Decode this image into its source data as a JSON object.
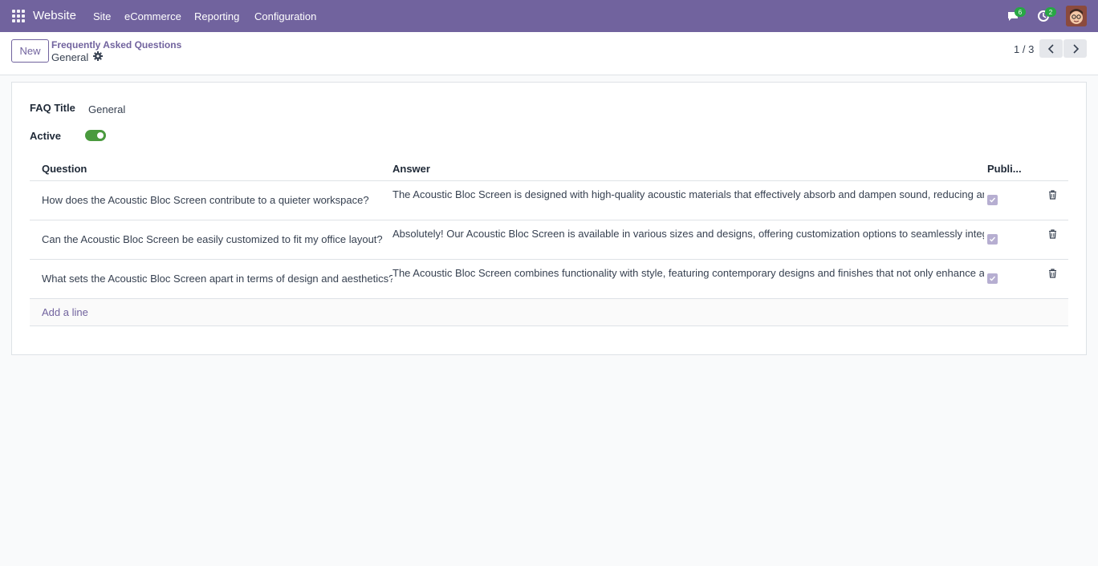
{
  "navbar": {
    "brand": "Website",
    "menu": [
      "Site",
      "eCommerce",
      "Reporting",
      "Configuration"
    ],
    "messages_count": "6",
    "activities_count": "2"
  },
  "control_panel": {
    "new_label": "New",
    "breadcrumb": "Frequently Asked Questions",
    "record_name": "General",
    "pager": "1 / 3"
  },
  "form": {
    "faq_title_label": "FAQ Title",
    "faq_title_value": "General",
    "active_label": "Active",
    "active": true
  },
  "table": {
    "headers": {
      "question": "Question",
      "answer": "Answer",
      "published": "Publi..."
    },
    "rows": [
      {
        "question": "How does the Acoustic Bloc Screen contribute to a quieter workspace?",
        "answer": "The Acoustic Bloc Screen is designed with high-quality acoustic materials that effectively absorb and dampen sound, reducing amb",
        "published": true
      },
      {
        "question": "Can the Acoustic Bloc Screen be easily customized to fit my office layout?",
        "answer": "Absolutely! Our Acoustic Bloc Screen is available in various sizes and designs, offering customization options to seamlessly integra",
        "published": true
      },
      {
        "question": "What sets the Acoustic Bloc Screen apart in terms of design and aesthetics?",
        "answer": "The Acoustic Bloc Screen combines functionality with style, featuring contemporary designs and finishes that not only enhance ac",
        "published": true
      }
    ],
    "add_line": "Add a line"
  },
  "colors": {
    "accent": "#71639e",
    "toggle_on": "#4a9a3e",
    "badge": "#28a745"
  }
}
